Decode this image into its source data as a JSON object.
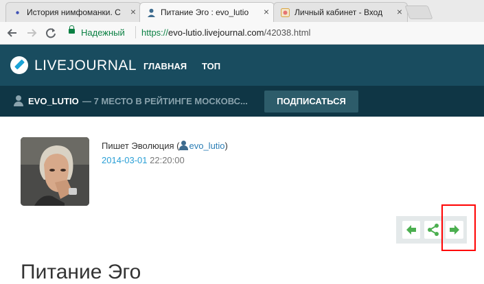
{
  "tabs": [
    {
      "label": "История нимфоманки. С",
      "active": false
    },
    {
      "label": "Питание Эго : evo_lutio",
      "active": true
    },
    {
      "label": "Личный кабинет - Вход",
      "active": false
    }
  ],
  "tab_close_glyph": "×",
  "address": {
    "secure_label": "Надежный",
    "url_protocol": "https://",
    "url_host": "evo-lutio.livejournal.com",
    "url_path": "/42038.html"
  },
  "header": {
    "logo_text": "LIVEJOURNAL",
    "nav": [
      "ГЛАВНАЯ",
      "ТОП"
    ]
  },
  "blogbar": {
    "username": "EVO_LUTIO",
    "rank_text": "— 7 МЕСТО В РЕЙТИНГЕ МОСКОВС...",
    "subscribe_label": "ПОДПИСАТЬСЯ"
  },
  "post": {
    "author_prefix": "Пишет Эволюция (",
    "author_link": "evo_lutio",
    "author_suffix": ")",
    "date": "2014-03-01",
    "time": "22:20:00",
    "title": "Питание Эго"
  },
  "colors": {
    "header_bg": "#194c5f",
    "blogbar_bg": "#0f3645",
    "nav_arrow": "#4caf50",
    "highlight": "#ff0000"
  },
  "icons": {
    "back": "back-icon",
    "forward": "forward-icon",
    "reload": "reload-icon",
    "lock": "lock-icon",
    "prev_post": "arrow-left-icon",
    "share": "share-icon",
    "next_post": "arrow-right-icon"
  }
}
